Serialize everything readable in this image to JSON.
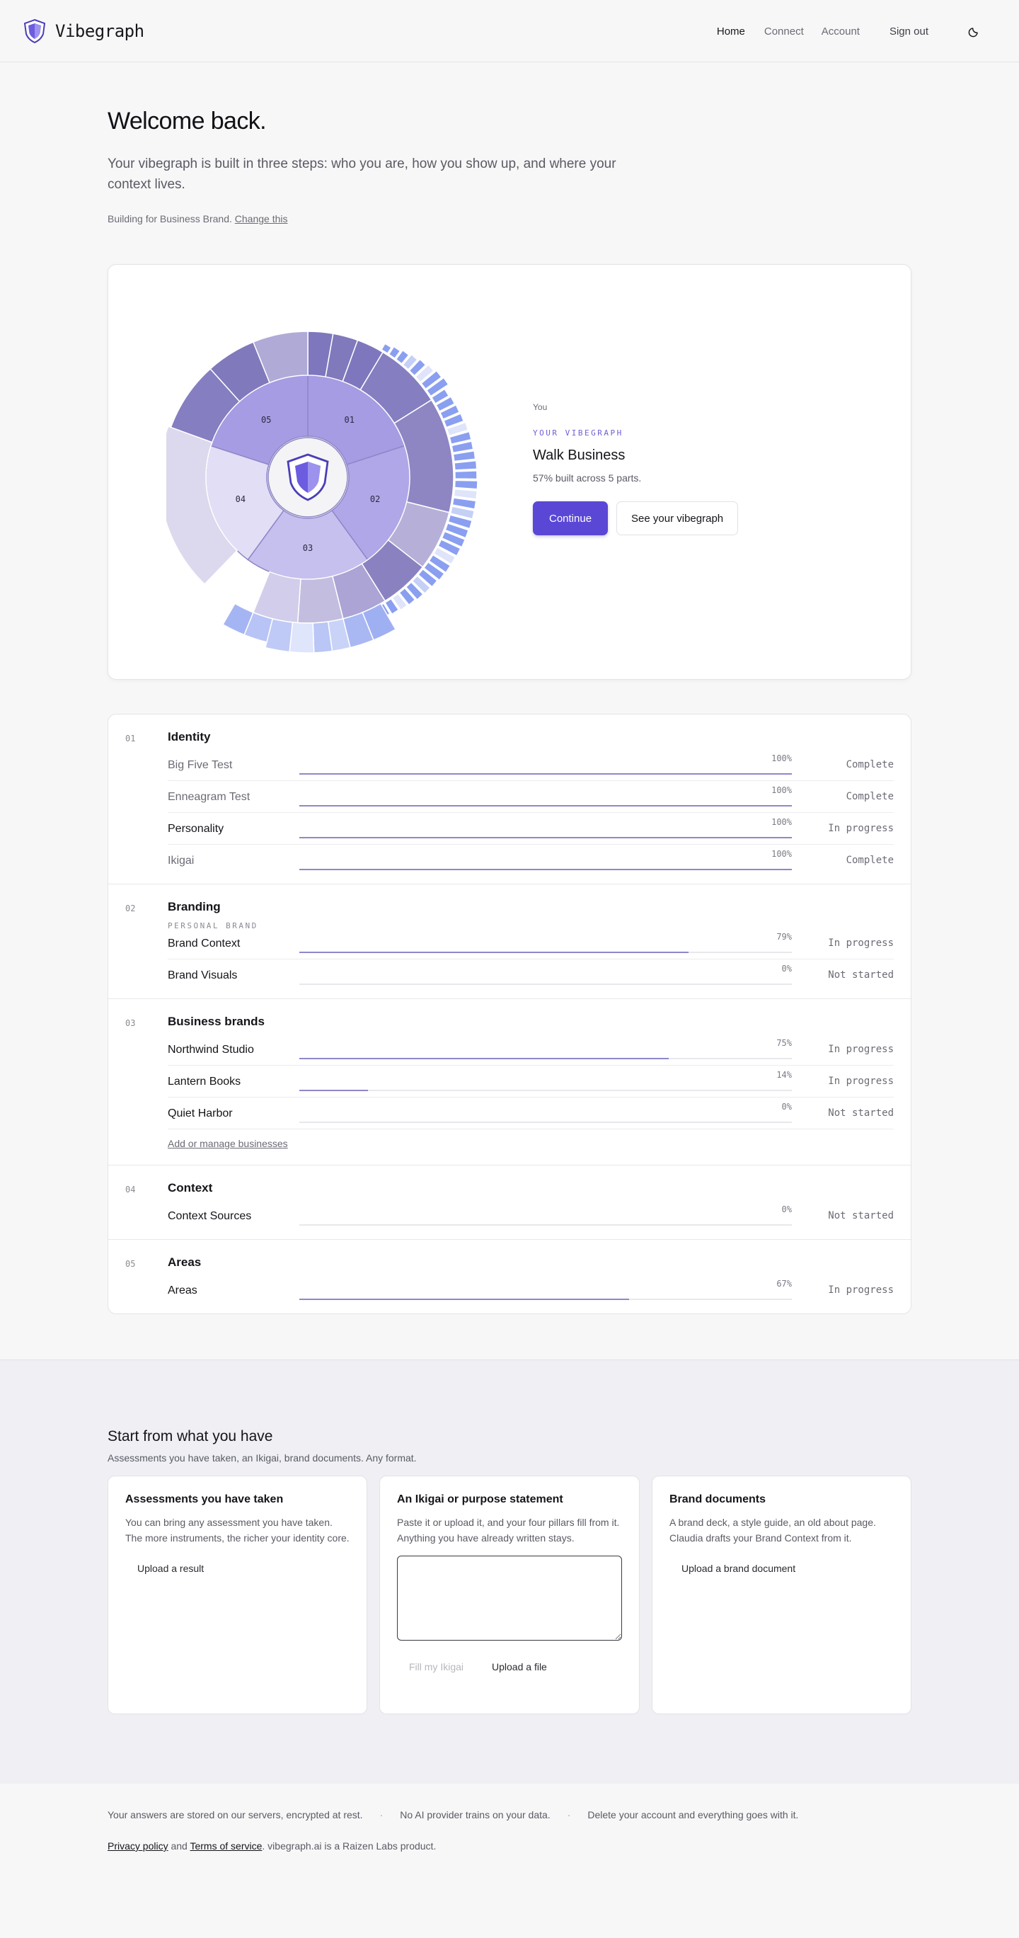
{
  "nav": {
    "brand": "Vibegraph",
    "links": {
      "home": "Home",
      "connect": "Connect",
      "account": "Account",
      "signout": "Sign out"
    }
  },
  "hero": {
    "title": "Welcome back.",
    "lead": "Your vibegraph is built in three steps: who you are, how you show up, and where your context lives.",
    "building_prefix": "Building for Business Brand.",
    "change_link": "Change this"
  },
  "vibe": {
    "you": "You",
    "eyebrow": "YOUR VIBEGRAPH",
    "name": "Walk Business",
    "built": "57% built across 5 parts.",
    "continue": "Continue",
    "see": "See your vibegraph",
    "segment_labels": [
      "01",
      "02",
      "03",
      "04",
      "05"
    ]
  },
  "sections": [
    {
      "num": "01",
      "title": "Identity",
      "subtitle": "",
      "rows": [
        {
          "name": "Big Five Test",
          "pct_label": "100%",
          "pct": 100,
          "status": "Complete",
          "done": true
        },
        {
          "name": "Enneagram Test",
          "pct_label": "100%",
          "pct": 100,
          "status": "Complete",
          "done": true
        },
        {
          "name": "Personality",
          "pct_label": "100%",
          "pct": 100,
          "status": "In progress",
          "done": false
        },
        {
          "name": "Ikigai",
          "pct_label": "100%",
          "pct": 100,
          "status": "Complete",
          "done": true
        }
      ],
      "link": ""
    },
    {
      "num": "02",
      "title": "Branding",
      "subtitle": "PERSONAL BRAND",
      "rows": [
        {
          "name": "Brand Context",
          "pct_label": "79%",
          "pct": 79,
          "status": "In progress",
          "done": false
        },
        {
          "name": "Brand Visuals",
          "pct_label": "0%",
          "pct": 0,
          "status": "Not started",
          "done": false
        }
      ],
      "link": ""
    },
    {
      "num": "03",
      "title": "Business brands",
      "subtitle": "",
      "rows": [
        {
          "name": "Northwind Studio",
          "pct_label": "75%",
          "pct": 75,
          "status": "In progress",
          "done": false
        },
        {
          "name": "Lantern Books",
          "pct_label": "14%",
          "pct": 14,
          "status": "In progress",
          "done": false
        },
        {
          "name": "Quiet Harbor",
          "pct_label": "0%",
          "pct": 0,
          "status": "Not started",
          "done": false
        }
      ],
      "link": "Add or manage businesses"
    },
    {
      "num": "04",
      "title": "Context",
      "subtitle": "",
      "rows": [
        {
          "name": "Context Sources",
          "pct_label": "0%",
          "pct": 0,
          "status": "Not started",
          "done": false
        }
      ],
      "link": ""
    },
    {
      "num": "05",
      "title": "Areas",
      "subtitle": "",
      "rows": [
        {
          "name": "Areas",
          "pct_label": "67%",
          "pct": 67,
          "status": "In progress",
          "done": false
        }
      ],
      "link": ""
    }
  ],
  "start": {
    "title": "Start from what you have",
    "subtitle": "Assessments you have taken, an Ikigai, brand documents. Any format.",
    "cards": [
      {
        "title": "Assessments you have taken",
        "body": "You can bring any assessment you have taken. The more instruments, the richer your identity core.",
        "action": "Upload a result"
      },
      {
        "title": "An Ikigai or purpose statement",
        "body": "Paste it or upload it, and your four pillars fill from it. Anything you have already written stays.",
        "action_disabled": "Fill my Ikigai",
        "action": "Upload a file"
      },
      {
        "title": "Brand documents",
        "body": "A brand deck, a style guide, an old about page. Claudia drafts your Brand Context from it.",
        "action": "Upload a brand document"
      }
    ]
  },
  "footer": {
    "notes": [
      "Your answers are stored on our servers, encrypted at rest.",
      "No AI provider trains on your data.",
      "Delete your account and everything goes with it."
    ],
    "privacy": "Privacy policy",
    "and": "and",
    "terms": "Terms of service",
    "suffix": ". vibegraph.ai is a Raizen Labs product."
  },
  "colors": {
    "accent": "#5b47d6",
    "bar_fill": "#8f87c9",
    "ring_dark": "#8079bb",
    "ring_mid": "#a59ce4",
    "ring_light": "#dcd9ee",
    "outer_blue": "#8a9ff0"
  },
  "icons": [
    "shield-logo-icon",
    "moon-icon"
  ]
}
